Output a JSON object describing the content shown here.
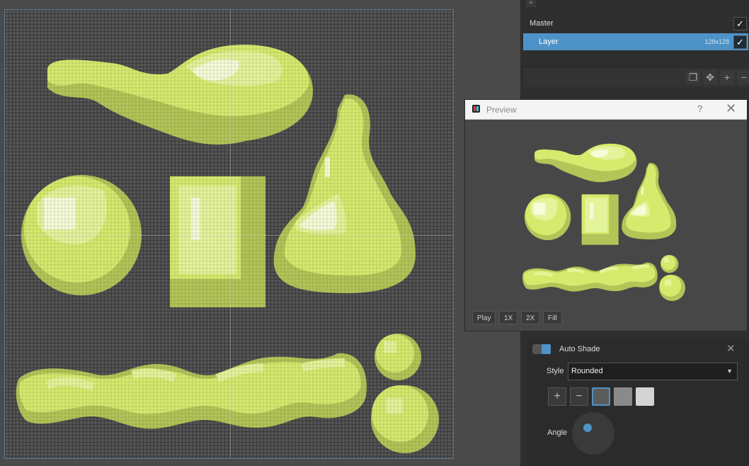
{
  "colors": {
    "accent": "#4d93c8",
    "sprite_light": "#e4f49a",
    "sprite_mid": "#d6ea6e",
    "sprite_dark": "#b4c458",
    "sprite_highlight": "#f6fbd8"
  },
  "layers": {
    "add_icon": "plus-icon",
    "items": [
      {
        "name": "Master",
        "size": "",
        "visible": true
      },
      {
        "name": "Layer",
        "size": "128x128",
        "visible": true
      }
    ],
    "checkmark": "✓",
    "toolbar": [
      "copy-icon",
      "move-icon",
      "plus-icon",
      "minus-icon"
    ]
  },
  "preview": {
    "title": "Preview",
    "help": "?",
    "close": "✕",
    "buttons": [
      "Play",
      "1X",
      "2X",
      "Fill"
    ]
  },
  "auto_shade": {
    "title": "Auto Shade",
    "close": "✕",
    "style_label": "Style",
    "style_value": "Rounded",
    "add": "+",
    "remove": "−",
    "swatches": [
      "#5c5c5c",
      "#8a8a8a",
      "#d4d4d4"
    ],
    "selected_swatch": 0,
    "angle_label": "Angle"
  }
}
